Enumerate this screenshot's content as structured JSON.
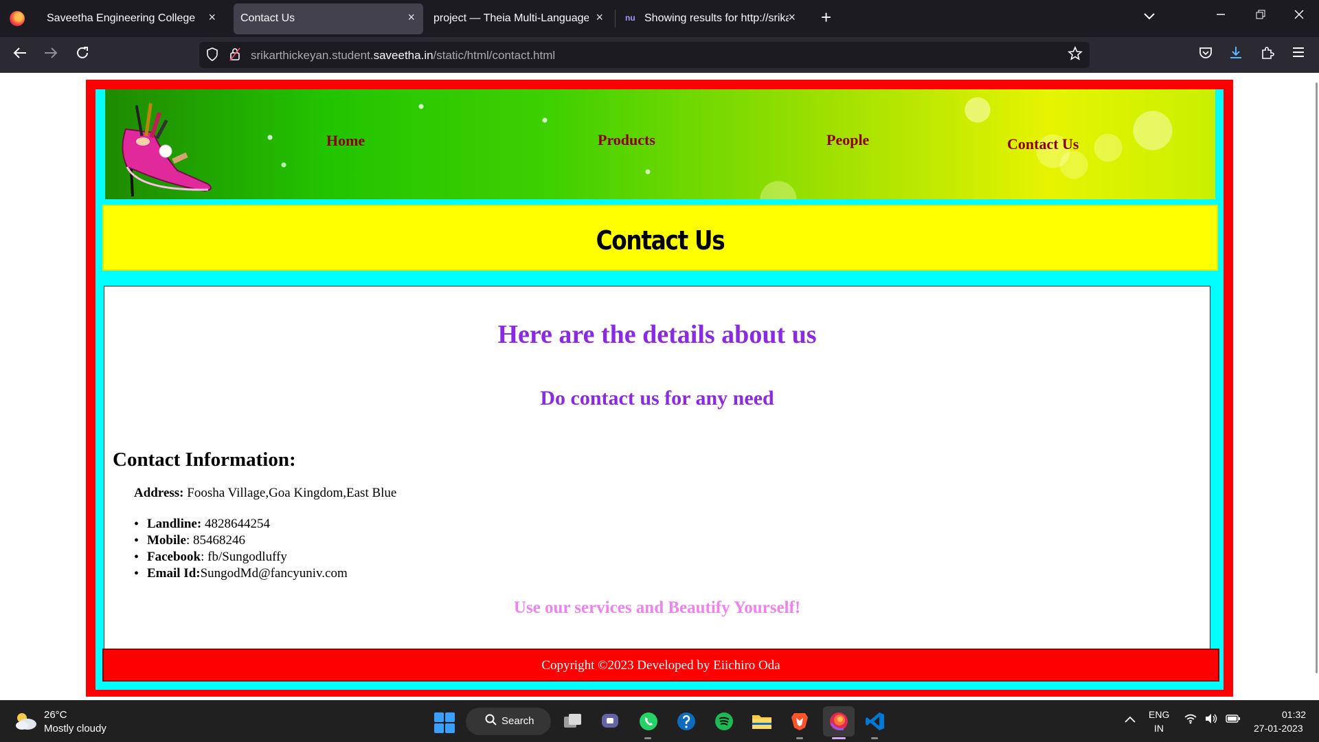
{
  "browser": {
    "tabs": [
      {
        "label": "Saveetha Engineering College",
        "close": "×"
      },
      {
        "label": "Contact Us",
        "close": "×"
      },
      {
        "label": "project — Theia Multi-Language Ex",
        "close": "×"
      },
      {
        "label": "Showing results for http://srikart",
        "close": "×",
        "favicon": "nu"
      }
    ],
    "new_tab": "+",
    "url_prefix": "srikarthickeyan.student.",
    "url_domain": "saveetha.in",
    "url_path": "/static/html/contact.html"
  },
  "page": {
    "nav": {
      "home": "Home",
      "products": "Products",
      "people": "People",
      "contact": "Contact Us"
    },
    "title": "Contact Us",
    "heading_details": "Here are the details about us",
    "heading_contact": "Do contact us for any need",
    "contact_info_heading": "Contact Information:",
    "address": {
      "label": "Address:",
      "value": " Foosha Village,Goa Kingdom,East Blue"
    },
    "contacts": [
      {
        "label": "Landline:",
        "value": " 4828644254"
      },
      {
        "label": "Mobile",
        "value": ": 85468246"
      },
      {
        "label": "Facebook",
        "value": ": fb/Sungodluffy"
      },
      {
        "label": "Email Id:",
        "value": "SungodMd@fancyuniv.com"
      }
    ],
    "slogan": "Use our services and Beautify Yourself!",
    "footer": "Copyright ©2023 Developed by Eiichiro Oda",
    "colors": {
      "outer_border": "#ff0000",
      "inner_border": "#00ffff",
      "title_band": "#ffff00",
      "nav_link": "#8b0000",
      "heading": "#8a2be2",
      "slogan": "#ee82ee"
    }
  },
  "taskbar": {
    "weather_temp": "26°C",
    "weather_desc": "Mostly cloudy",
    "search_label": "Search",
    "lang_line1": "ENG",
    "lang_line2": "IN",
    "time": "01:32",
    "date": "27-01-2023"
  }
}
